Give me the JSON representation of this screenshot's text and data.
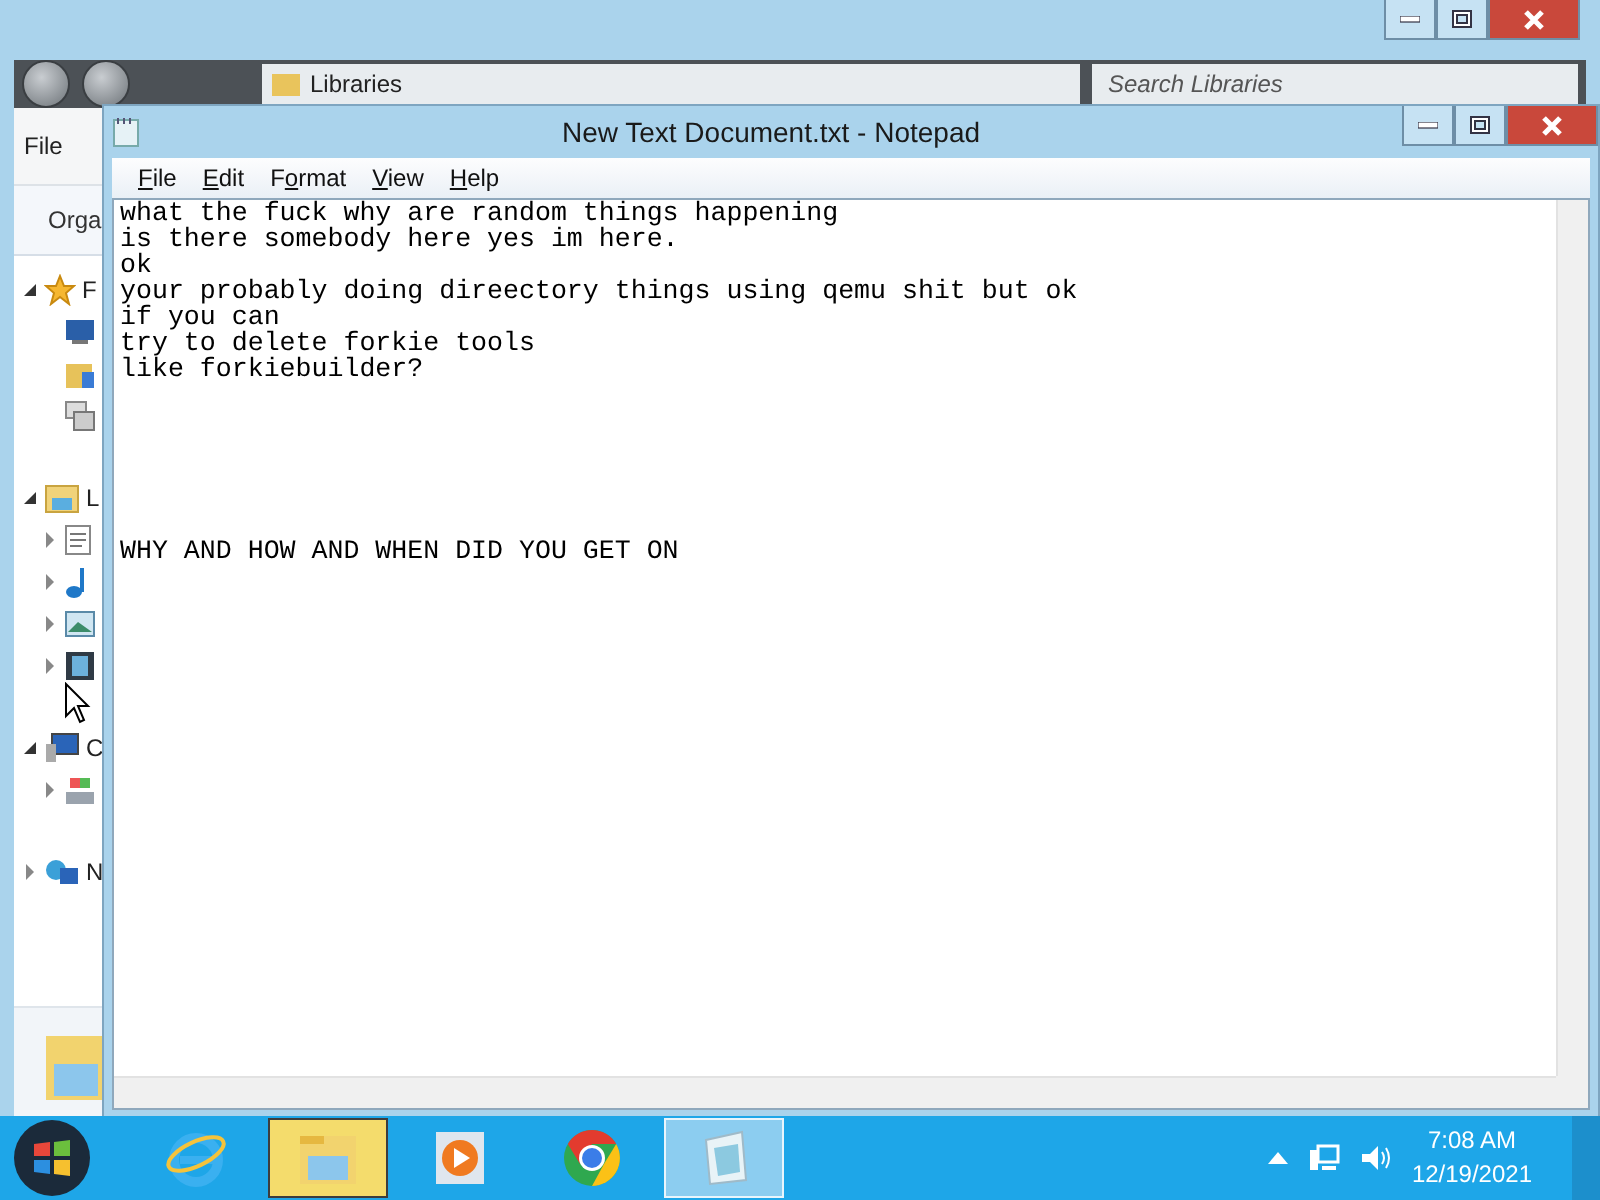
{
  "explorer": {
    "address": "Libraries",
    "search": {
      "placeholder": "Search Libraries"
    },
    "menu": [
      "File"
    ],
    "toolbar": [
      "Orga"
    ],
    "tree": [
      {
        "kind": "favorites",
        "label": "F",
        "expanded": true,
        "children": [
          {
            "kind": "desktop"
          },
          {
            "kind": "downloads"
          },
          {
            "kind": "recent"
          }
        ]
      },
      {
        "kind": "libraries",
        "label": "L",
        "expanded": true,
        "children": [
          {
            "kind": "documents",
            "expanded": false
          },
          {
            "kind": "music",
            "expanded": false
          },
          {
            "kind": "pictures",
            "expanded": false
          },
          {
            "kind": "videos",
            "expanded": false
          }
        ]
      },
      {
        "kind": "computer",
        "label": "C",
        "expanded": true,
        "children": [
          {
            "kind": "disk",
            "expanded": false
          }
        ]
      },
      {
        "kind": "network",
        "label": "N",
        "expanded": false
      }
    ]
  },
  "notepad": {
    "title": "New Text Document.txt - Notepad",
    "menu": [
      {
        "key": "F",
        "rest": "ile"
      },
      {
        "key": "E",
        "rest": "dit"
      },
      {
        "lead": "F",
        "key": "o",
        "rest": "rmat"
      },
      {
        "key": "V",
        "rest": "iew"
      },
      {
        "key": "H",
        "rest": "elp"
      }
    ],
    "text": "what the fuck why are random things happening\nis there somebody here yes im here.\nok\nyour probably doing direectory things using qemu shit but ok\nif you can\ntry to delete forkie tools\nlike forkiebuilder?\n\n\n\n\n\n\nWHY AND HOW AND WHEN DID YOU GET ON"
  },
  "taskbar": {
    "apps": [
      {
        "kind": "ie",
        "running": false
      },
      {
        "kind": "explorer",
        "running": true
      },
      {
        "kind": "media",
        "running": false
      },
      {
        "kind": "chrome",
        "running": false
      },
      {
        "kind": "notepad",
        "running": true
      }
    ],
    "clock": {
      "time": "7:08 AM",
      "date": "12/19/2021"
    }
  }
}
